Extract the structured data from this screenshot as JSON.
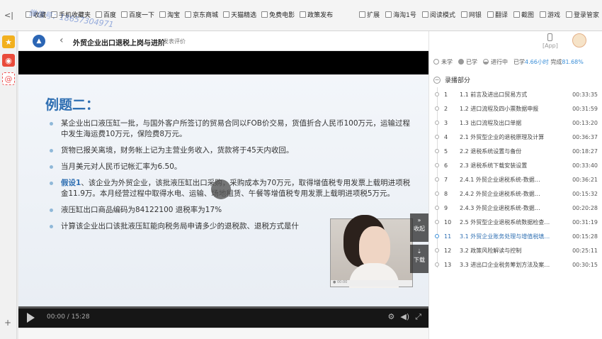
{
  "browser": {
    "back": "<|",
    "watermark": "微信号：18657304971",
    "bookmarks": [
      "收藏",
      "手机收藏夹",
      "百度",
      "百度一下",
      "淘宝",
      "京东商城",
      "天猫精选",
      "免费电影",
      "政策发布"
    ],
    "right": [
      "扩展",
      "海淘1号",
      "阅读模式",
      "网银",
      "翻译",
      "截图",
      "游戏",
      "登录管家"
    ]
  },
  "rail": [
    "收藏",
    "微博",
    "邮件"
  ],
  "header": {
    "title": "外贸企业出口退税上岗与进阶",
    "rate": "发表评价"
  },
  "slide": {
    "heading": "例题二：",
    "bullets": [
      "某企业出口液压缸一批，与国外客户所签订的贸易合同以FOB价交易，货值折合人民币100万元，运输过程中发生海运费10万元，保险费8万元。",
      "货物已报关离境，财务帐上记为主营业务收入，货款将于45天内收回。",
      "当月美元对人民币记帐汇率为6.50。",
      "假设1、该企业为外贸企业，该批液压缸出口采购，采购成本为70万元，取得增值税专用发票上载明进项税金11.9万。本月经营过程中取得水电、运输、场地租赁、午餐等增值税专用发票上载明进项税5万元。",
      "液压缸出口商品编码为84122100 退税率为17%",
      "计算该企业出口该批液压缸能向税务局申请多少的退税款、退税方式是什"
    ],
    "highlight": "假设1"
  },
  "side_buttons": {
    "collapse": "收起",
    "download": "下载"
  },
  "controls": {
    "time": "00:00 / 15:28"
  },
  "panel": {
    "app_label": "[App]",
    "legend": {
      "not_learned": "未学",
      "learned": "已学",
      "in_progress": "进行中",
      "progress_prefix": "已学",
      "hours": "4.66小时",
      "done_prefix": "完成",
      "done_pct": "81.68%"
    },
    "section": "录播部分",
    "lessons": [
      {
        "num": "1",
        "title": "1.1 前言及进出口贸易方式",
        "duration": "00:33:35"
      },
      {
        "num": "2",
        "title": "1.2 进口流程及四小票数据申报",
        "duration": "00:31:59"
      },
      {
        "num": "3",
        "title": "1.3 出口流程及出口单据",
        "duration": "00:13:20"
      },
      {
        "num": "4",
        "title": "2.1 外贸型企业的退税原理及计算",
        "duration": "00:36:37"
      },
      {
        "num": "5",
        "title": "2.2 退税系统设置与备份",
        "duration": "00:18:27"
      },
      {
        "num": "6",
        "title": "2.3 退税系统下载安装设置",
        "duration": "00:33:40"
      },
      {
        "num": "7",
        "title": "2.4.1 外贸企业退税系统-数据…",
        "duration": "00:36:21"
      },
      {
        "num": "8",
        "title": "2.4.2 外贸企业退税系统-数据…",
        "duration": "00:15:32"
      },
      {
        "num": "9",
        "title": "2.4.3 外贸企业退税系统-数据…",
        "duration": "00:20:28"
      },
      {
        "num": "10",
        "title": "2.5 外贸型企业退税系统数据检查…",
        "duration": "00:31:19"
      },
      {
        "num": "11",
        "title": "3.1 外贸企业账务处理与增值税填…",
        "duration": "00:15:28"
      },
      {
        "num": "12",
        "title": "3.2 政策风险解读与控制",
        "duration": "00:25:11"
      },
      {
        "num": "13",
        "title": "3.3 进出口企业税务筹划方法及案…",
        "duration": "00:30:15"
      }
    ]
  }
}
